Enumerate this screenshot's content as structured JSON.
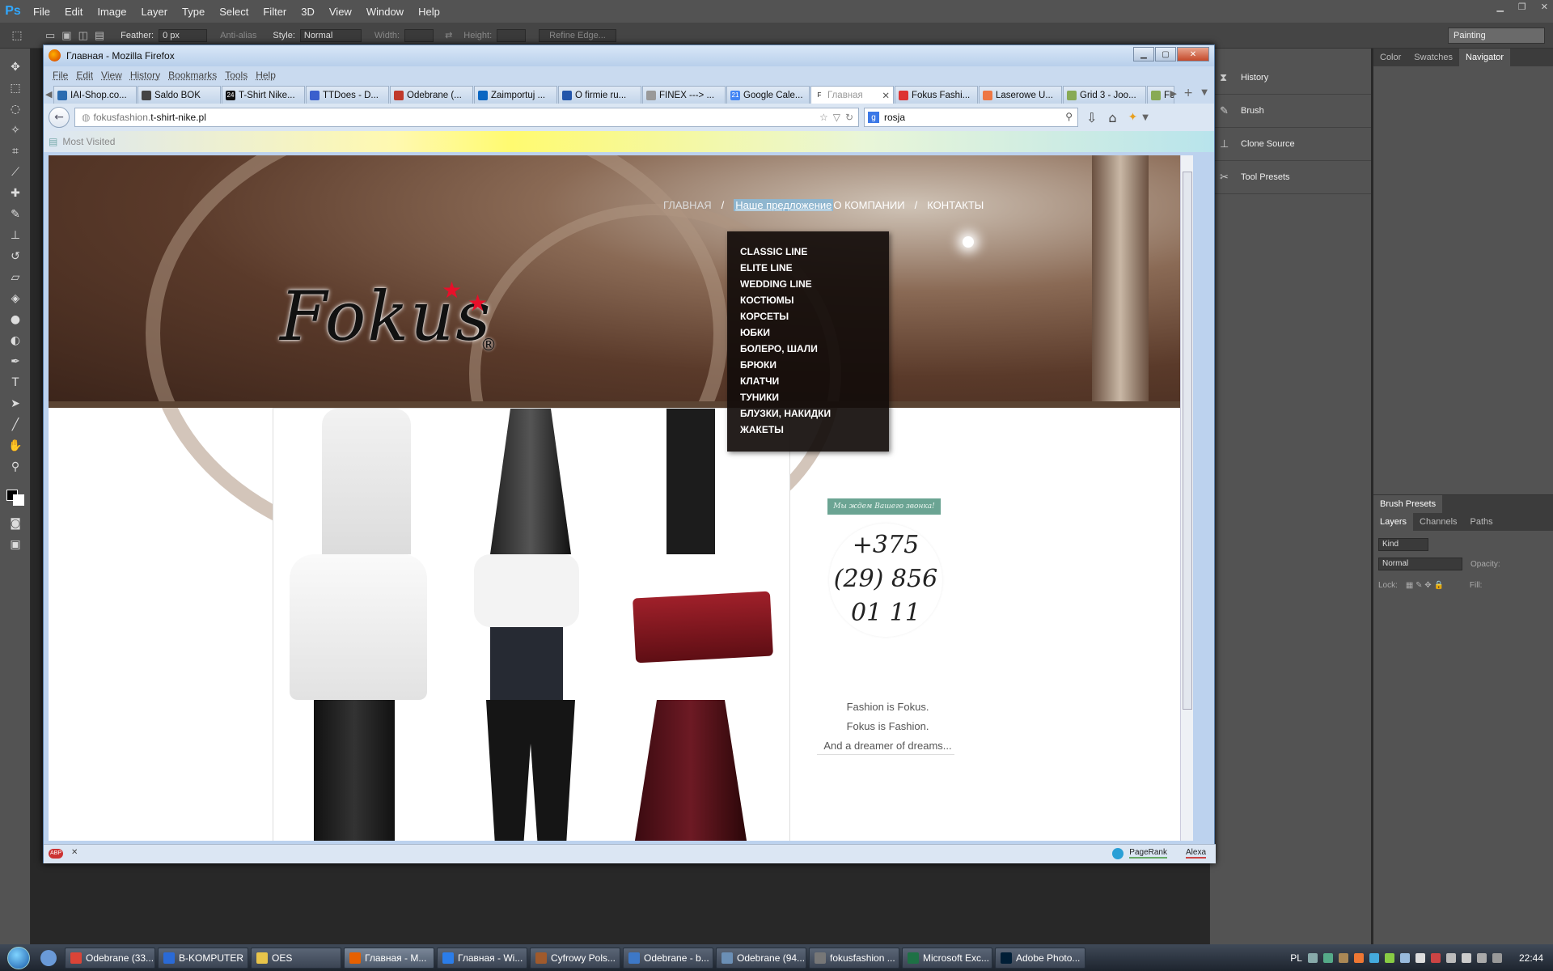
{
  "photoshop": {
    "logo": "Ps",
    "menu": [
      "File",
      "Edit",
      "Image",
      "Layer",
      "Type",
      "Select",
      "Filter",
      "3D",
      "View",
      "Window",
      "Help"
    ],
    "options": {
      "feather_label": "Feather:",
      "feather_value": "0 px",
      "antialias_label": "Anti-alias",
      "style_label": "Style:",
      "style_value": "Normal",
      "width_label": "Width:",
      "height_label": "Height:",
      "refine_edge": "Refine Edge..."
    },
    "workspace": "Painting",
    "collapsed_panels": [
      "History",
      "Brush",
      "Clone Source",
      "Tool Presets"
    ],
    "top_tabs": [
      "Color",
      "Swatches",
      "Navigator"
    ],
    "brush_presets_tab": "Brush Presets",
    "layers_tabs": [
      "Layers",
      "Channels",
      "Paths"
    ],
    "layers": {
      "kind": "Kind",
      "blend": "Normal",
      "opacity_label": "Opacity:",
      "lock_label": "Lock:",
      "fill_label": "Fill:"
    }
  },
  "firefox": {
    "title": "Главная - Mozilla Firefox",
    "menu": [
      "File",
      "Edit",
      "View",
      "History",
      "Bookmarks",
      "Tools",
      "Help"
    ],
    "tabs": [
      {
        "label": "IAI-Shop.co...",
        "color": "#2b6cb0"
      },
      {
        "label": "Saldo BOK",
        "color": "#444"
      },
      {
        "label": "T-Shirt Nike...",
        "color": "#111",
        "icon": "24"
      },
      {
        "label": "TTDoes - D...",
        "color": "#3a5fcd"
      },
      {
        "label": "Odebrane (...",
        "color": "#c0392b"
      },
      {
        "label": "Zaimportuj ...",
        "color": "#0a66c2"
      },
      {
        "label": "O firmie ru...",
        "color": "#2255aa"
      },
      {
        "label": "FINEX ---> ...",
        "color": "#999"
      },
      {
        "label": "Google Cale...",
        "color": "#4285f4",
        "icon": "21"
      },
      {
        "label": "Главная",
        "color": "#fff",
        "icon": "F",
        "active": true
      },
      {
        "label": "Fokus Fashi...",
        "color": "#d33"
      },
      {
        "label": "Laserowe U...",
        "color": "#e74"
      },
      {
        "label": "Grid 3 - Joo...",
        "color": "#8a5"
      },
      {
        "label": "Fo",
        "color": "#8a5"
      }
    ],
    "url_prefix": "fokusfashion.",
    "url_domain": "t-shirt-nike.pl",
    "search_value": "rosja",
    "bookmarks_label": "Most Visited",
    "status_items": [
      "PageRank",
      "Alexa"
    ]
  },
  "site": {
    "nav": {
      "home": "ГЛАВНАЯ",
      "sep": "/",
      "offer": "Наше предложение",
      "about": "О КОМПАНИИ",
      "contacts": "КОНТАКТЫ"
    },
    "dropdown": [
      "CLASSIC LINE",
      "ELITE LINE",
      "WEDDING LINE",
      "КОСТЮМЫ",
      "КОРСЕТЫ",
      "ЮБКИ",
      "БОЛЕРО, ШАЛИ",
      "БРЮКИ",
      "КЛАТЧИ",
      "ТУНИКИ",
      "БЛУЗКИ, НАКИДКИ",
      "ЖАКЕТЫ"
    ],
    "logo_text": "Fokus",
    "logo_reg": "®",
    "call_note": "Мы ждем Вашего звонка!",
    "phone_lines": [
      "+375",
      "(29) 856",
      "01 11"
    ],
    "tagline": [
      "Fashion is Fokus.",
      "Fokus is Fashion.",
      "And a dreamer of dreams..."
    ]
  },
  "taskbar": {
    "items": [
      {
        "label": "Odebrane (33...",
        "color": "#db4437"
      },
      {
        "label": "B-KOMPUTER",
        "color": "#2a6ad6"
      },
      {
        "label": "OES",
        "color": "#e8c44a"
      },
      {
        "label": "Главная - M...",
        "color": "#e66000",
        "active": true
      },
      {
        "label": "Главная - Wi...",
        "color": "#2b7de9"
      },
      {
        "label": "Cyfrowy Pols...",
        "color": "#a05a2c"
      },
      {
        "label": "Odebrane - b...",
        "color": "#3d78c7"
      },
      {
        "label": "Odebrane (94...",
        "color": "#6b8fb5"
      },
      {
        "label": "fokusfashion ...",
        "color": "#777"
      },
      {
        "label": "Microsoft Exc...",
        "color": "#1e7145"
      },
      {
        "label": "Adobe Photo...",
        "color": "#001e36"
      }
    ],
    "lang": "PL",
    "clock": "22:44"
  }
}
